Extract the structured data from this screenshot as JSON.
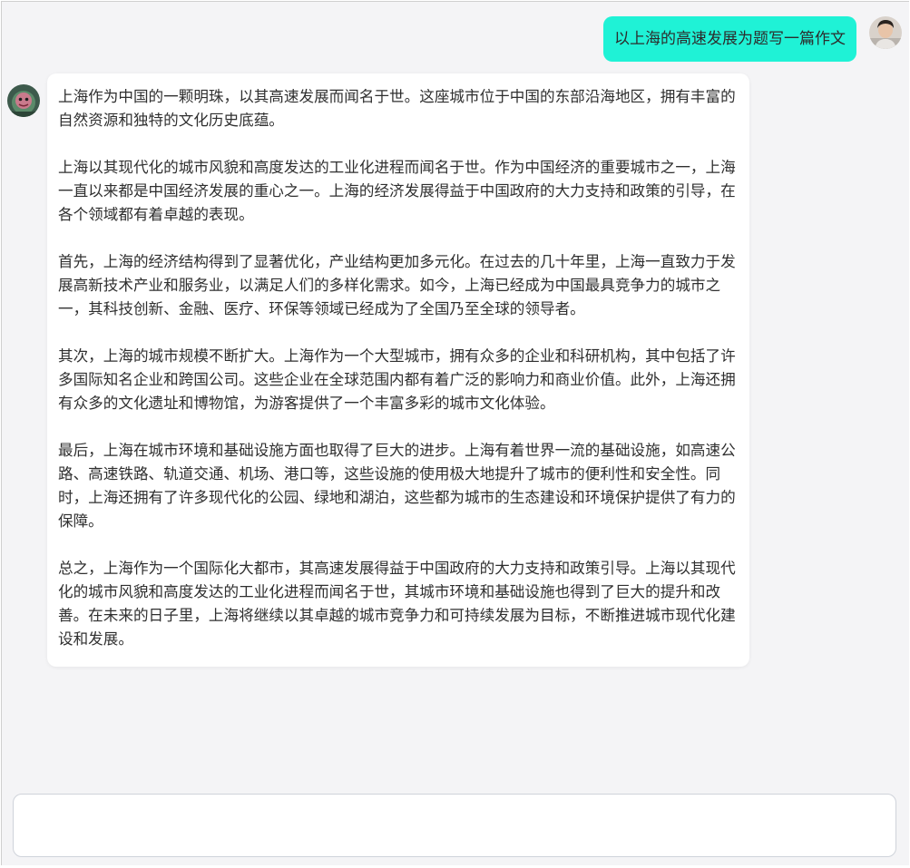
{
  "conversation": {
    "user_message": "以上海的高速发展为题写一篇作文",
    "bot_paragraphs": [
      "上海作为中国的一颗明珠，以其高速发展而闻名于世。这座城市位于中国的东部沿海地区，拥有丰富的自然资源和独特的文化历史底蕴。",
      "上海以其现代化的城市风貌和高度发达的工业化进程而闻名于世。作为中国经济的重要城市之一，上海一直以来都是中国经济发展的重心之一。上海的经济发展得益于中国政府的大力支持和政策的引导，在各个领域都有着卓越的表现。",
      "首先，上海的经济结构得到了显著优化，产业结构更加多元化。在过去的几十年里，上海一直致力于发展高新技术产业和服务业，以满足人们的多样化需求。如今，上海已经成为中国最具竞争力的城市之一，其科技创新、金融、医疗、环保等领域已经成为了全国乃至全球的领导者。",
      "其次，上海的城市规模不断扩大。上海作为一个大型城市，拥有众多的企业和科研机构，其中包括了许多国际知名企业和跨国公司。这些企业在全球范围内都有着广泛的影响力和商业价值。此外，上海还拥有众多的文化遗址和博物馆，为游客提供了一个丰富多彩的城市文化体验。",
      "最后，上海在城市环境和基础设施方面也取得了巨大的进步。上海有着世界一流的基础设施，如高速公路、高速铁路、轨道交通、机场、港口等，这些设施的使用极大地提升了城市的便利性和安全性。同时，上海还拥有了许多现代化的公园、绿地和湖泊，这些都为城市的生态建设和环境保护提供了有力的保障。",
      "总之，上海作为一个国际化大都市，其高速发展得益于中国政府的大力支持和政策引导。上海以其现代化的城市风貌和高度发达的工业化进程而闻名于世，其城市环境和基础设施也得到了巨大的提升和改善。在未来的日子里，上海将继续以其卓越的城市竞争力和可持续发展为目标，不断推进城市现代化建设和发展。"
    ]
  },
  "composer": {
    "value": "",
    "placeholder": ""
  },
  "colors": {
    "user_bubble": "#1ff2d6",
    "bot_bubble": "#ffffff",
    "background": "#f4f4f6"
  },
  "icons": {
    "user_avatar": "user-avatar-icon",
    "bot_avatar": "bot-avatar-icon"
  }
}
